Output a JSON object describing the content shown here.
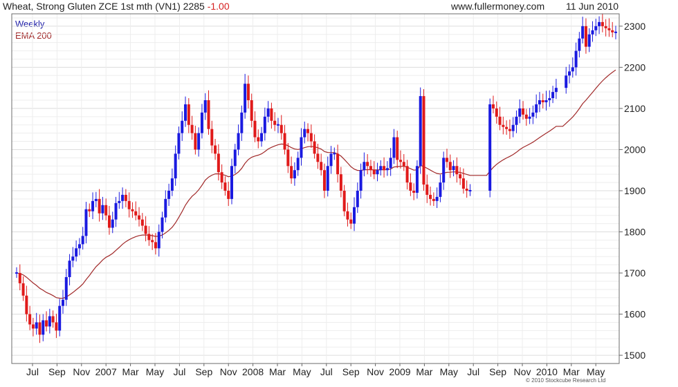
{
  "header": {
    "instrument": "Wheat, Strong Gluten ZCE 1st mth (VN1)",
    "last_price": "2285",
    "change": "-1.00",
    "website": "www.fullermoney.com",
    "date": "11 Jun 2010"
  },
  "legend": {
    "interval": "Weekly",
    "indicator": "EMA 200"
  },
  "copyright": "© 2010 Stockcube Research Ltd",
  "chart_data": {
    "type": "candlestick",
    "title": "Wheat, Strong Gluten ZCE 1st mth (VN1) 2285 -1.00",
    "xlabel": "",
    "ylabel": "",
    "ylim": [
      1480,
      2330
    ],
    "yticks": [
      1500,
      1600,
      1700,
      1800,
      1900,
      2000,
      2100,
      2200,
      2300
    ],
    "x_tick_labels": [
      "Jul",
      "Sep",
      "Nov",
      "2007",
      "Mar",
      "May",
      "Jul",
      "Sep",
      "Nov",
      "2008",
      "Mar",
      "May",
      "Jul",
      "Sep",
      "Nov",
      "2009",
      "Mar",
      "May",
      "Jul",
      "Sep",
      "Nov",
      "2010",
      "Mar",
      "May"
    ],
    "grid": true,
    "y_axis_side": "right",
    "colors": {
      "up": "#1a1ae0",
      "down": "#e01a1a",
      "ema": "#a02828",
      "grid": "#e6e6e6"
    },
    "close_series": [
      1700,
      1675,
      1645,
      1600,
      1575,
      1565,
      1580,
      1550,
      1585,
      1570,
      1595,
      1580,
      1560,
      1620,
      1635,
      1690,
      1730,
      1740,
      1760,
      1770,
      1790,
      1855,
      1850,
      1875,
      1880,
      1845,
      1865,
      1840,
      1810,
      1830,
      1870,
      1875,
      1890,
      1875,
      1855,
      1850,
      1840,
      1830,
      1815,
      1795,
      1780,
      1775,
      1760,
      1800,
      1835,
      1880,
      1900,
      1930,
      1990,
      2040,
      2070,
      2110,
      2060,
      2040,
      2000,
      2040,
      2090,
      2120,
      2050,
      2010,
      1990,
      1945,
      1920,
      1900,
      1880,
      1960,
      2000,
      2040,
      2090,
      2160,
      2120,
      2070,
      2030,
      2020,
      2040,
      2080,
      2100,
      2070,
      2060,
      2060,
      2040,
      2000,
      1960,
      1930,
      1950,
      1980,
      2030,
      2050,
      2040,
      2020,
      1990,
      1970,
      1950,
      1900,
      1960,
      1990,
      1990,
      1940,
      1900,
      1850,
      1830,
      1820,
      1860,
      1900,
      1950,
      1970,
      1960,
      1950,
      1940,
      1950,
      1960,
      1950,
      1955,
      1980,
      2030,
      1975,
      1970,
      1960,
      1920,
      1900,
      1895,
      1960,
      2130,
      1915,
      1890,
      1880,
      1875,
      1885,
      1920,
      1980,
      1970,
      1950,
      1960,
      1940,
      1930,
      1905,
      1900,
      1900,
      null,
      null,
      null,
      null,
      null,
      2110,
      2100,
      2080,
      2060,
      2055,
      2050,
      2045,
      2060,
      2080,
      2100,
      2085,
      2075,
      2080,
      2090,
      2110,
      2120,
      2115,
      2120,
      2125,
      2140,
      2150,
      null,
      null,
      2180,
      2190,
      2200,
      2240,
      2270,
      2300,
      2250,
      2280,
      2290,
      2300,
      2310,
      2300,
      2295,
      2290,
      2285,
      2285
    ]
  }
}
